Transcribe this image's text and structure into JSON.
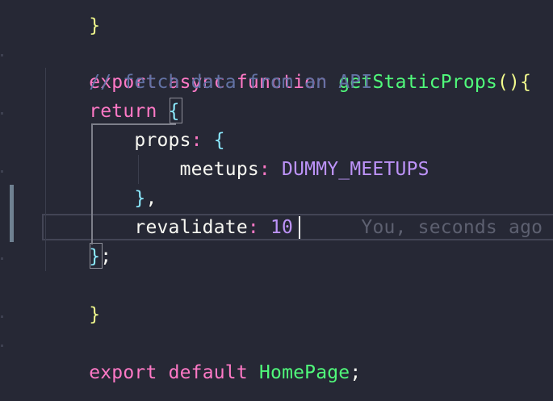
{
  "colors": {
    "background": "#262835",
    "keyword": "#ff79c6",
    "function": "#50fa7b",
    "bracket": "#f1fa8c",
    "comment": "#6272a4",
    "property": "#f8f8f2",
    "constant": "#bd93f9",
    "object_brace": "#8be9fd",
    "blame": "#5d6070",
    "modified_gutter": "#6f8191"
  },
  "code": {
    "line1": {
      "kw_export": "export",
      "kw_async": "async",
      "kw_function": "function",
      "fn_name": "getStaticProps",
      "punct": "(){"
    },
    "line2": {
      "comment": "// fetch data from an API"
    },
    "line3": {
      "kw_return": "return",
      "brace": "{"
    },
    "line4": {
      "prop": "props",
      "colon": ":",
      "brace": "{"
    },
    "line5": {
      "prop": "meetups",
      "colon": ":",
      "value": "DUMMY_MEETUPS"
    },
    "line6": {
      "brace": "}",
      "comma": ","
    },
    "line7": {
      "prop": "revalidate",
      "colon": ":",
      "value": "10",
      "blame": "You, seconds ago"
    },
    "line8": {
      "brace": "}",
      "semicolon": ";"
    },
    "line9": {
      "brace": "}"
    },
    "line11": {
      "kw_export": "export",
      "kw_default": "default",
      "component": "HomePage",
      "semicolon": ";"
    }
  }
}
